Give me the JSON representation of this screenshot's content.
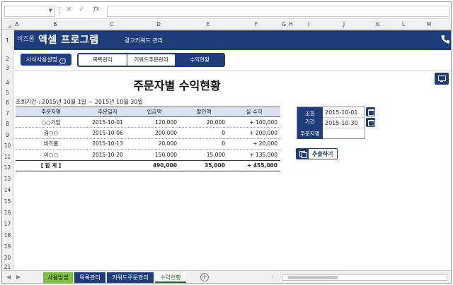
{
  "formula_bar": {
    "cancel_icon": "✕",
    "enter_icon": "✓",
    "fx_label": "fx",
    "value": ""
  },
  "columns": [
    "A",
    "B",
    "C",
    "D",
    "E",
    "F",
    "G",
    "H",
    "I",
    "J",
    "K",
    "L",
    "M"
  ],
  "rows": [
    "1",
    "2",
    "3",
    "4",
    "5",
    "6",
    "7",
    "8",
    "9",
    "10",
    "11",
    "12",
    "13",
    "14",
    "15",
    "16",
    "17",
    "18",
    "19",
    "20",
    "21"
  ],
  "banner": {
    "logo_small": "비즈폼",
    "logo_big": "엑셀 프로그램",
    "subtitle": "광고키워드 관리",
    "phone_icon": "phone-icon"
  },
  "manual_button": {
    "label": "사식사용설명",
    "arrow": "›"
  },
  "tabs": [
    "목록관리",
    "키워드주문관리",
    "수익현황"
  ],
  "page_title": "주문자별 수익현황",
  "period_text": "조회기간 : 2015년 10월 1일 ~ 2015년 10월 30일",
  "table": {
    "headers": [
      "주문자명",
      "주문일자",
      "입금액",
      "할인액",
      "실 수익"
    ],
    "rows": [
      [
        "○○기업",
        "2015-10-01",
        "120,000",
        "20,000",
        "+ 100,000"
      ],
      [
        "김○○",
        "2015-10-06",
        "200,000",
        "0",
        "+ 200,000"
      ],
      [
        "비즈폼",
        "2015-10-13",
        "20,000",
        "0",
        "+ 20,000"
      ],
      [
        "이○○",
        "2015-10-20",
        "150,000",
        "15,000",
        "+ 135,000"
      ]
    ],
    "total": [
      "[ 합 계 ]",
      "",
      "490,000",
      "35,000",
      "+ 455,000"
    ]
  },
  "search_panel": {
    "period_label_1": "조회",
    "period_label_2": "기간",
    "start_date": "2015-10-01",
    "end_date": "2015-10-30",
    "orderer_label": "주문자명",
    "orderer_value": ""
  },
  "extract_button": "추출하기",
  "sheet_tabs": [
    {
      "label": "사용방법",
      "color": "#7fbf3f"
    },
    {
      "label": "목록관리",
      "color": "#1f3d7a"
    },
    {
      "label": "키워드주문관리",
      "color": "#1f3d7a"
    },
    {
      "label": "수익현황",
      "color": "#ffffff"
    }
  ],
  "add_sheet": "+",
  "colors": {
    "brand": "#1f3d7a",
    "header_fill": "#dbe1ef"
  }
}
